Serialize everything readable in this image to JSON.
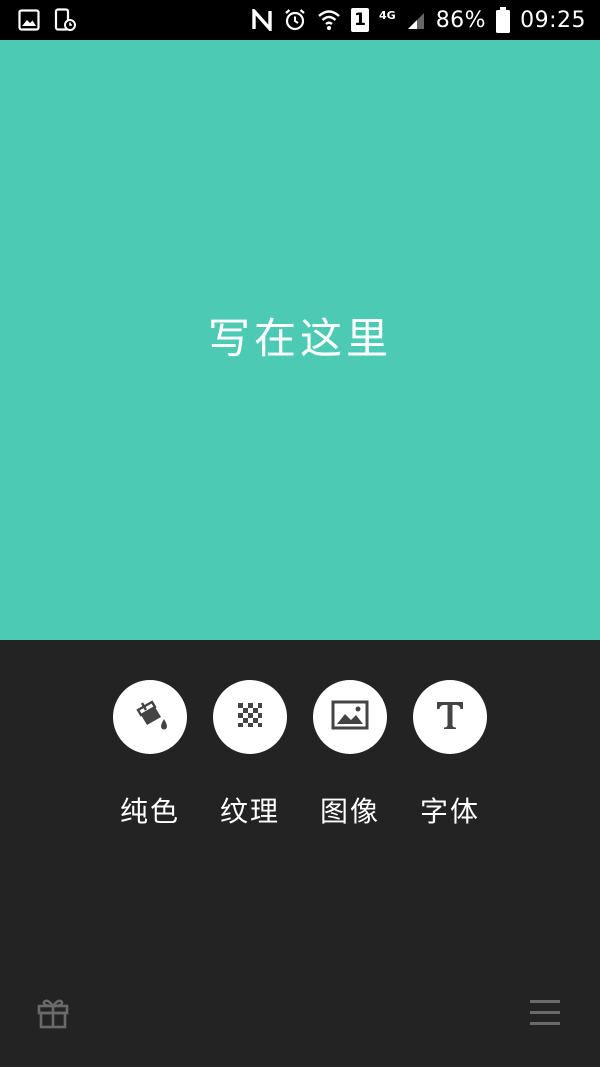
{
  "status_bar": {
    "network_type": "4G",
    "sim_slot": "1",
    "battery_percent": "86%",
    "time": "09:25",
    "icons": [
      "image-icon",
      "phone-clock-icon",
      "nfc-icon",
      "alarm-icon",
      "wifi-icon",
      "sim-icon",
      "signal-icon",
      "battery-icon"
    ]
  },
  "canvas": {
    "background_color": "#4ccab3",
    "text": "写在这里"
  },
  "toolbar": {
    "tools": [
      {
        "icon": "paint-bucket-icon",
        "label": "纯色"
      },
      {
        "icon": "texture-icon",
        "label": "纹理"
      },
      {
        "icon": "image-icon",
        "label": "图像"
      },
      {
        "icon": "font-icon",
        "label": "字体"
      }
    ]
  },
  "footer": {
    "left_icon": "gift-icon",
    "right_icon": "menu-icon"
  }
}
